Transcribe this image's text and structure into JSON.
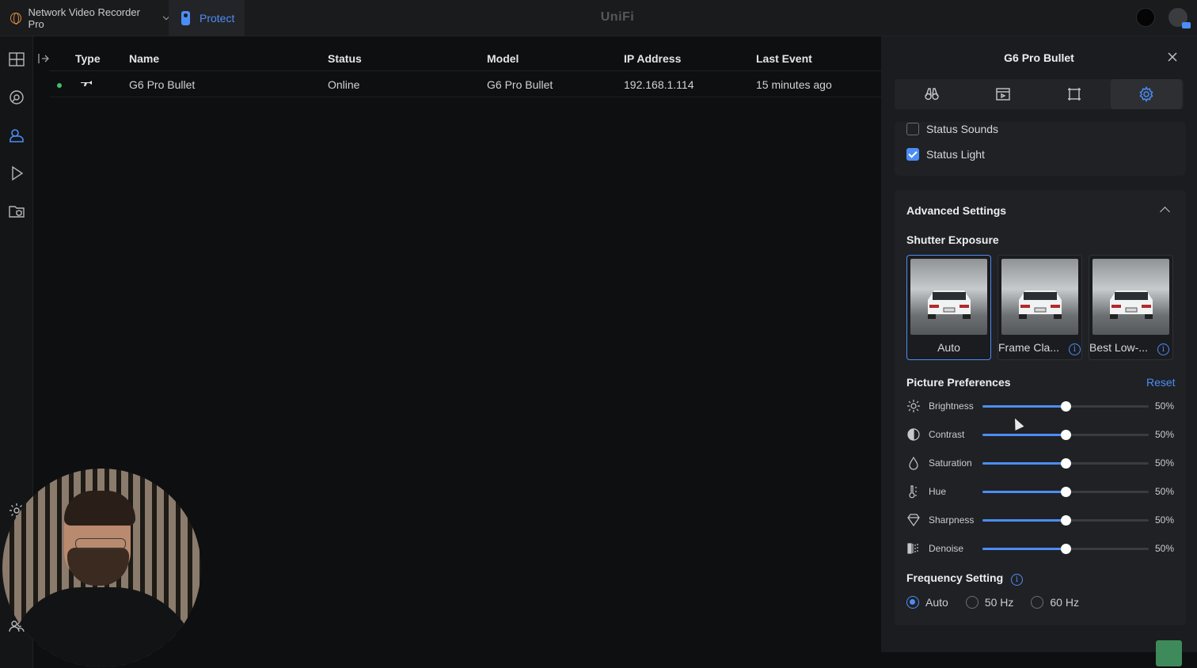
{
  "topbar": {
    "app_switcher_label": "Network Video Recorder Pro",
    "active_app_label": "Protect",
    "brand": "UniFi"
  },
  "table": {
    "headers": [
      "Type",
      "Name",
      "Status",
      "Model",
      "IP Address",
      "Last Event"
    ],
    "rows": [
      {
        "name": "G6 Pro Bullet",
        "status": "Online",
        "model": "G6 Pro Bullet",
        "ip": "192.168.1.114",
        "last_event": "15 minutes ago"
      }
    ]
  },
  "panel": {
    "title": "G6 Pro Bullet",
    "tabs": [
      "binoculars-icon",
      "recording-icon",
      "frame-icon",
      "gear-icon"
    ],
    "active_tab": 3,
    "status_options": [
      {
        "label": "Status Sounds",
        "checked": false
      },
      {
        "label": "Status Light",
        "checked": true
      }
    ],
    "advanced": {
      "title": "Advanced Settings",
      "shutter_title": "Shutter Exposure",
      "shutter_options": [
        {
          "label": "Auto",
          "selected": true
        },
        {
          "label": "Frame Cla...",
          "selected": false,
          "info": "i"
        },
        {
          "label": "Best Low-...",
          "selected": false,
          "info": "i"
        }
      ],
      "picture_title": "Picture Preferences",
      "reset_label": "Reset",
      "sliders": [
        {
          "label": "Brightness",
          "value": "50%",
          "level": 0.5
        },
        {
          "label": "Contrast",
          "value": "50%",
          "level": 0.5
        },
        {
          "label": "Saturation",
          "value": "50%",
          "level": 0.5
        },
        {
          "label": "Hue",
          "value": "50%",
          "level": 0.5
        },
        {
          "label": "Sharpness",
          "value": "50%",
          "level": 0.5
        },
        {
          "label": "Denoise",
          "value": "50%",
          "level": 0.5
        }
      ],
      "frequency_title": "Frequency Setting",
      "frequency_info": "i",
      "frequency_options": [
        {
          "label": "Auto",
          "selected": true
        },
        {
          "label": "50 Hz",
          "selected": false
        },
        {
          "label": "60 Hz",
          "selected": false
        }
      ]
    }
  },
  "colors": {
    "accent": "#4c8df5",
    "online": "#3bc16a",
    "panel_bg": "#1b1c1f"
  }
}
